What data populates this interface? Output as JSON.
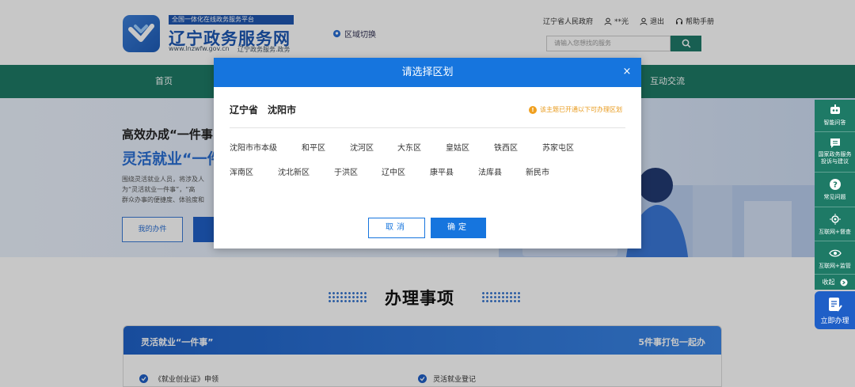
{
  "header": {
    "logo_tag": "全国一体化在线政务服务平台",
    "site_name": "辽宁政务服务网",
    "site_url": "www.lnzwfw.gov.cn",
    "site_sub": "辽宁政务服务.政务",
    "region_switch": "区域切换",
    "links": {
      "gov": "辽宁省人民政府",
      "user": "**光",
      "logout": "退出",
      "help": "帮助手册"
    },
    "search_placeholder": "请输入您想找的服务"
  },
  "nav": {
    "home": "首页",
    "interaction": "互动交流"
  },
  "hero": {
    "title1": "高效办成“一件事”",
    "title2": "灵活就业“一件",
    "desc_line1": "围绕灵活就业人员，将涉及人",
    "desc_line2": "为“灵活就业一件事”，“高",
    "desc_line3": "群众办事的便捷度、体验度和",
    "my_items_btn": "我的办件"
  },
  "rail": {
    "items": [
      "智能问答",
      "国家政务服务投诉与建议",
      "常见问题",
      "互联网+督查",
      "互联网+监管"
    ],
    "collapse": "收起",
    "online": "立即办理"
  },
  "section": {
    "title": "办理事项",
    "card_title": "灵活就业“一件事”",
    "card_right": "5件事打包一起办",
    "item1": "《就业创业证》申领",
    "item2": "灵活就业登记"
  },
  "modal": {
    "title": "请选择区划",
    "close": "×",
    "province": "辽宁省",
    "city": "沈阳市",
    "notice": "该主题已开通以下可办理区划",
    "districts": [
      "沈阳市市本级",
      "和平区",
      "沈河区",
      "大东区",
      "皇姑区",
      "铁西区",
      "苏家屯区",
      "浑南区",
      "沈北新区",
      "于洪区",
      "辽中区",
      "康平县",
      "法库县",
      "新民市"
    ],
    "cancel": "取消",
    "ok": "确定"
  },
  "colors": {
    "primary": "#1675de",
    "nav_green": "#1e7a66",
    "notice": "#e89a1b"
  }
}
